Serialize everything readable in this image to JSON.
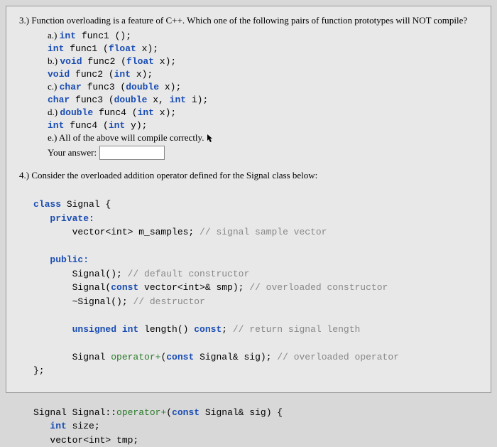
{
  "q3": {
    "prompt": "3.) Function overloading is a feature of C++. Which one of the following pairs of function prototypes will NOT compile?",
    "a_label": "a.)",
    "a_line1_pre": "int ",
    "a_line1_post": "func1 ();",
    "a_line2_pre": "int ",
    "a_line2_mid": "func1 (",
    "a_line2_kw": "float",
    "a_line2_end": " x);",
    "b_label": "b.)",
    "b_line1_pre": "void ",
    "b_line1_mid": "func2 (",
    "b_line1_kw": "float",
    "b_line1_end": " x);",
    "b_line2_pre": "void ",
    "b_line2_mid": "func2 (",
    "b_line2_kw": "int",
    "b_line2_end": " x);",
    "c_label": "c.)",
    "c_line1_pre": "char ",
    "c_line1_mid": "func3 (",
    "c_line1_kw": "double",
    "c_line1_end": " x);",
    "c_line2_pre": "char ",
    "c_line2_mid": "func3 (",
    "c_line2_kw1": "double",
    "c_line2_mid2": " x, ",
    "c_line2_kw2": "int",
    "c_line2_end": " i);",
    "d_label": "d.)",
    "d_line1_pre": "double ",
    "d_line1_mid": "func4 (",
    "d_line1_kw": "int",
    "d_line1_end": " x);",
    "d_line2_pre": "int ",
    "d_line2_mid": "func4 (",
    "d_line2_kw": "int",
    "d_line2_end": " y);",
    "e_label": "e.)",
    "e_text": " All of the above will compile correctly. ",
    "your_answer_label": "Your answer:"
  },
  "q4": {
    "prompt": "4.) Consider the overloaded addition operator defined for the Signal class below:",
    "code": {
      "l1_kw": "class ",
      "l1_rest": "Signal {",
      "l2_kw": "private:",
      "l3": "vector<int> m_samples; ",
      "l3_c": "// signal sample vector",
      "l4_kw": "public:",
      "l5": "Signal(); ",
      "l5_c": "// default constructor",
      "l6a": "Signal(",
      "l6_kw": "const",
      "l6b": " vector<int>& smp); ",
      "l6_c": "// overloaded constructor",
      "l7": "~Signal(); ",
      "l7_c": "// destructor",
      "l8_kw1": "unsigned int",
      "l8_mid": " length() ",
      "l8_kw2": "const",
      "l8_end": "; ",
      "l8_c": "// return signal length",
      "l9a": "Signal ",
      "l9_kw1": "operator+",
      "l9_mid": "(",
      "l9_kw2": "const",
      "l9_end": " Signal& sig); ",
      "l9_c": "// overloaded operator",
      "l10": "};",
      "l11a": "Signal Signal::",
      "l11_kw1": "operator+",
      "l11_mid": "(",
      "l11_kw2": "const",
      "l11_end": " Signal& sig) {",
      "l12_kw": "int",
      "l12_rest": " size;",
      "l13": "vector<int> tmp;"
    }
  }
}
